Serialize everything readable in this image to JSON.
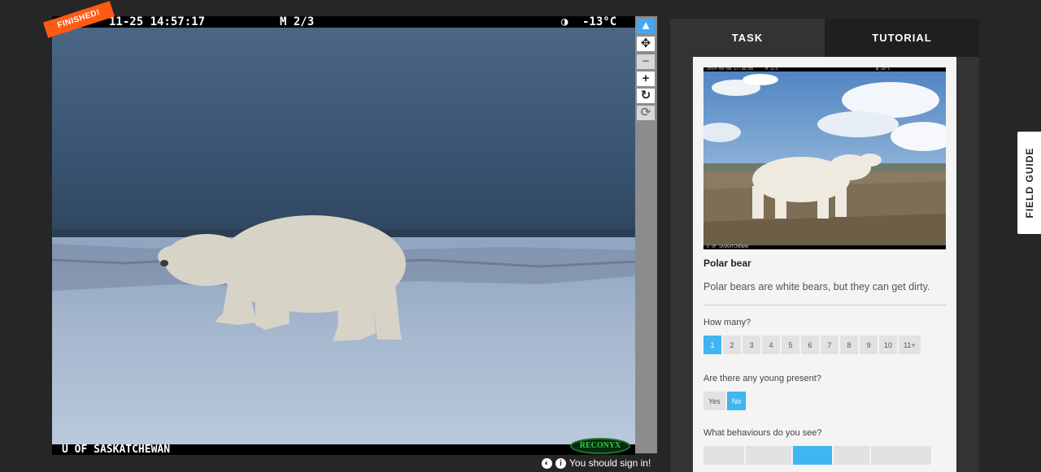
{
  "viewer": {
    "finished_label": "FINISHED!",
    "hud_date": "11-25 14:57:17",
    "hud_counter": "M 2/3",
    "hud_moon": "◑",
    "hud_temp": "-13°C",
    "hud_bottom": "U OF SASKATCHEWAN",
    "brand": "RECONYX"
  },
  "tools": {
    "select": "▲",
    "pan": "✥",
    "zoom_out": "−",
    "zoom_in": "+",
    "rotate": "↻",
    "reset": "⟳"
  },
  "signin": {
    "text": "You should sign in!"
  },
  "tabs": [
    {
      "label": "TASK"
    },
    {
      "label": "TUTORIAL"
    }
  ],
  "species": {
    "hud_top": "2014-09-08 17:38:00     M 1/3                                        ◑ 10°C",
    "hud_bottom": "U OF SASKATCHEWAN",
    "name": "Polar bear",
    "description": "Polar bears are white bears, but they can get dirty."
  },
  "questions": {
    "how_many": {
      "label": "How many?",
      "options": [
        "1",
        "2",
        "3",
        "4",
        "5",
        "6",
        "7",
        "8",
        "9",
        "10",
        "11+"
      ],
      "selected": "1"
    },
    "young": {
      "label": "Are there any young present?",
      "options": [
        "Yes",
        "No"
      ],
      "selected": "No"
    },
    "behaviours": {
      "label": "What behaviours do you see?"
    }
  },
  "field_guide": "FIELD GUIDE"
}
